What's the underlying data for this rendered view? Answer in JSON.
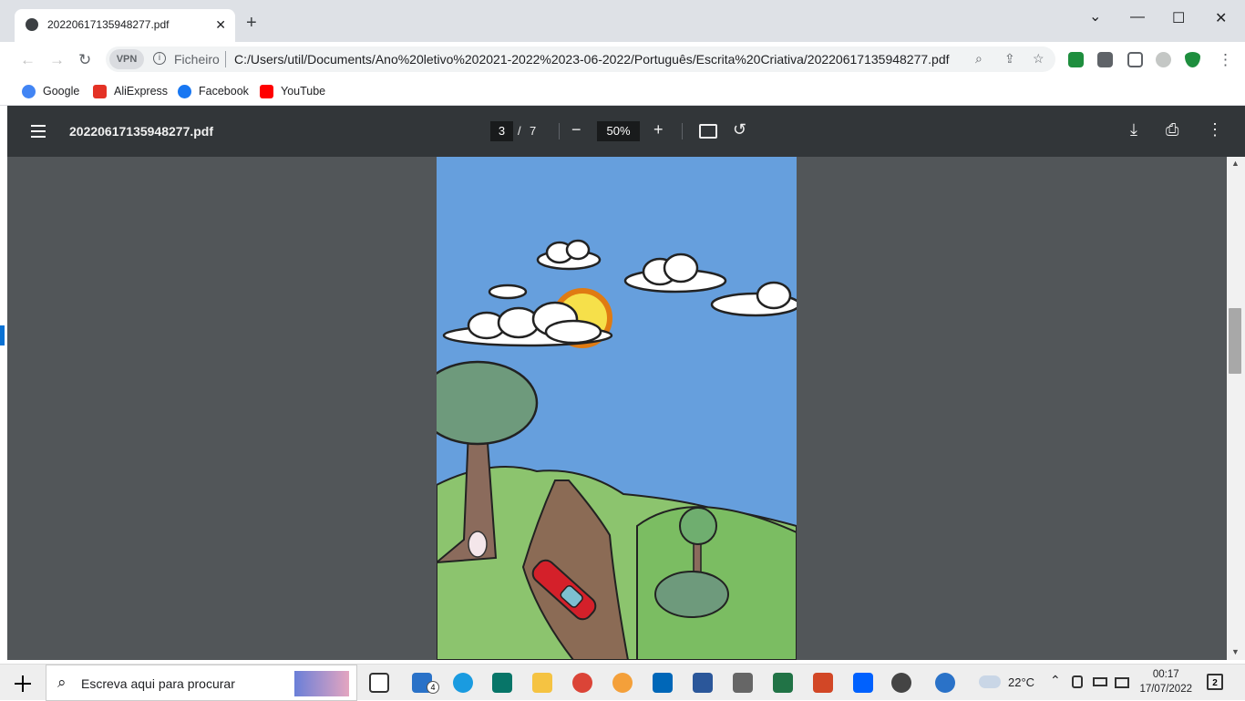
{
  "browser": {
    "tab_title": "20220617135948277.pdf",
    "tab_close": "✕",
    "new_tab": "+",
    "window_controls": {
      "dropdown": "⌄",
      "minimize": "—",
      "maximize": "☐",
      "close": "✕"
    }
  },
  "toolbar": {
    "vpn_badge": "VPN",
    "scheme_label": "Ficheiro",
    "url": "C:/Users/util/Documents/Ano%20letivo%202021-2022%2023-06-2022/Português/Escrita%20Criativa/20220617135948277.pdf"
  },
  "bookmarks": [
    {
      "label": "Google",
      "color": "#4285f4"
    },
    {
      "label": "AliExpress",
      "color": "#e43225"
    },
    {
      "label": "Facebook",
      "color": "#1877f2"
    },
    {
      "label": "YouTube",
      "color": "#ff0000"
    }
  ],
  "pdf": {
    "filename": "20220617135948277.pdf",
    "page_current": "3",
    "page_sep": "/",
    "page_total": "7",
    "zoom": "50%"
  },
  "taskbar": {
    "search_placeholder": "Escreva aqui para procurar",
    "mail_badge": "4",
    "weather": "22°C",
    "time": "00:17",
    "date": "17/07/2022"
  },
  "colors": {
    "pdf_toolbar": "#323639",
    "viewer_bg": "#525659",
    "sky": "#5a95d8",
    "grass": "#8cc46e",
    "road": "#8b6b55",
    "car": "#d4202a"
  }
}
